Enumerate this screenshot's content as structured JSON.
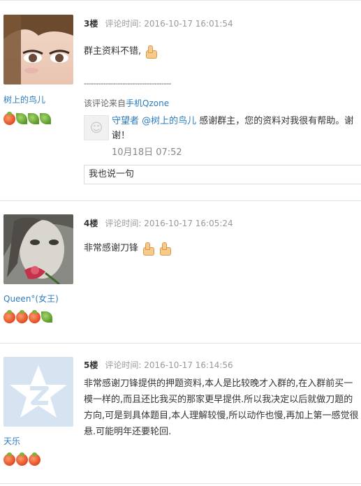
{
  "posts": [
    {
      "floor": "3楼",
      "time_label": "评论时间: 2016-10-17 16:01:54",
      "username": "树上的鸟儿",
      "avatar": "anime-girl-eyes-avatar",
      "badges": [
        "peach",
        "leaf",
        "leaf",
        "leaf"
      ],
      "text": "群主资料不错,",
      "dashes": "------------------------------------",
      "from_prefix": "该评论来自",
      "from_link": "手机Qzone",
      "reply": {
        "author": "守望者",
        "mention": "@树上的鸟儿",
        "text": " 感谢群主，您的资料对我很有帮助。谢谢！",
        "time": "10月18日 07:52"
      },
      "reply_box": "我也说一句"
    },
    {
      "floor": "4楼",
      "time_label": "评论时间: 2016-10-17 16:05:24",
      "username": "Queen°(女王)",
      "avatar": "woman-with-rose-avatar",
      "badges": [
        "peach",
        "peach",
        "peach",
        "leaf"
      ],
      "text": "非常感谢刀锋"
    },
    {
      "floor": "5楼",
      "time_label": "评论时间: 2016-10-17 16:14:56",
      "username": "天乐",
      "avatar": "qq-default-avatar",
      "badges": [
        "peach",
        "peach",
        "peach"
      ],
      "text": "非常感谢刀锋提供的押题资料,本人是比较晚才入群的,在入群前买一模一样的,而且还比我买的那家更早提供.所以我决定以后就做刀题的方向,可是到具体题目,本人理解较慢,所以动作也慢,再加上第一感觉很悬.可能明年还要轮回."
    }
  ],
  "colors": {
    "link": "#2a7cbf",
    "separator": "#d9e6ee"
  }
}
